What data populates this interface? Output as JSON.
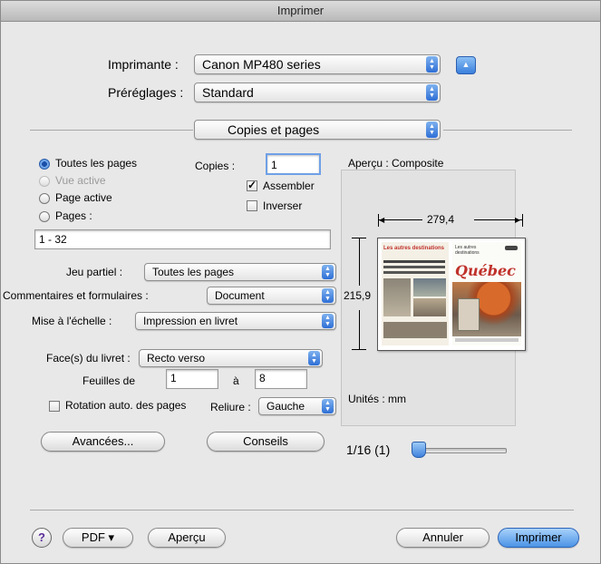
{
  "window": {
    "title": "Imprimer"
  },
  "printer": {
    "label": "Imprimante :",
    "value": "Canon MP480 series"
  },
  "presets": {
    "label": "Préréglages :",
    "value": "Standard"
  },
  "panel": {
    "value": "Copies et pages"
  },
  "pages": {
    "all_label": "Toutes les pages",
    "view_label": "Vue active",
    "current_label": "Page active",
    "range_label": "Pages :",
    "range_value": "1 - 32",
    "selected": "all"
  },
  "copies": {
    "label": "Copies :",
    "value": "1",
    "collate_label": "Assembler",
    "collate_checked": true,
    "reverse_label": "Inverser",
    "reverse_checked": false
  },
  "subset": {
    "label": "Jeu partiel :",
    "value": "Toutes les pages"
  },
  "comments": {
    "label": "Commentaires et formulaires :",
    "value": "Document"
  },
  "scaling": {
    "label": "Mise à l'échelle :",
    "value": "Impression en livret"
  },
  "booklet": {
    "faces_label": "Face(s) du livret :",
    "faces_value": "Recto verso",
    "sheets_from_label": "Feuilles de",
    "sheets_from": "1",
    "sheets_to_label": "à",
    "sheets_to": "8",
    "autorotate_label": "Rotation auto. des pages",
    "autorotate_checked": false,
    "binding_label": "Reliure :",
    "binding_value": "Gauche"
  },
  "buttons": {
    "advanced": "Avancées...",
    "tips": "Conseils",
    "pdf": "PDF ▾",
    "preview": "Aperçu",
    "cancel": "Annuler",
    "print": "Imprimer",
    "help": "?"
  },
  "preview": {
    "title": "Aperçu : Composite",
    "width": "279,4",
    "height": "215,9",
    "units": "Unités : mm",
    "page_indicator": "1/16 (1)",
    "left_page_title": "Les autres destinations",
    "right_page_small": "Les autres destinations",
    "right_page_title": "Québec"
  },
  "icons": {
    "popup_arrows": "up-down-arrows-icon",
    "disclosure": "triangle-up-icon"
  },
  "colors": {
    "accent": "#3a7fdc",
    "title_red": "#c0312b"
  },
  "slider": {
    "position_fraction": 0.0
  }
}
